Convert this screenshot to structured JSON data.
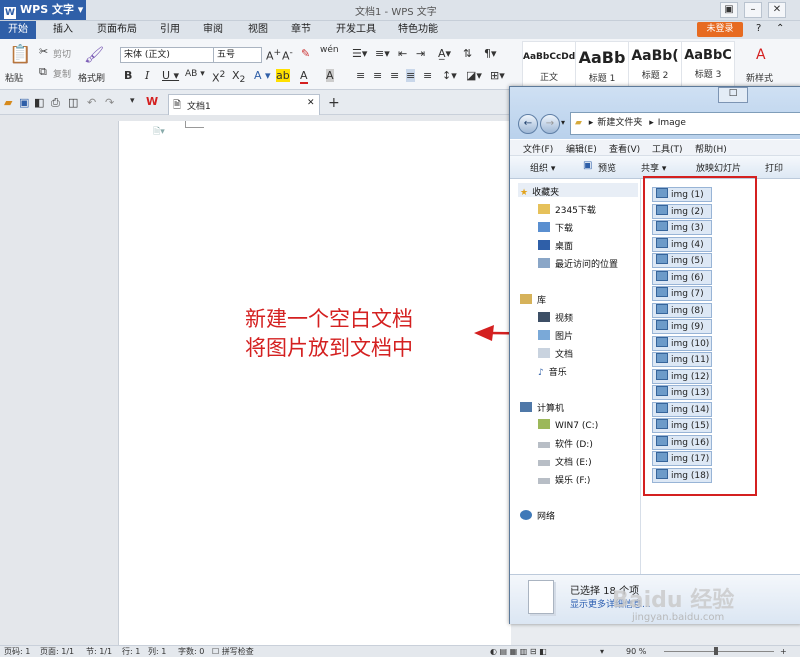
{
  "titlebar": {
    "app_name": "WPS 文字",
    "doc_title": "文档1 - WPS 文字",
    "login": "未登录"
  },
  "menu_tabs": [
    "开始",
    "插入",
    "页面布局",
    "引用",
    "审阅",
    "视图",
    "章节",
    "开发工具",
    "特色功能"
  ],
  "ribbon": {
    "paste": "粘贴",
    "cut": "剪切",
    "copy": "复制",
    "format_painter": "格式刷",
    "font_name": "宋体 (正文)",
    "font_size": "五号",
    "styles": [
      {
        "sample": "AaBbCcDd",
        "name": "正文"
      },
      {
        "sample": "AaBb",
        "name": "标题 1"
      },
      {
        "sample": "AaBb(",
        "name": "标题 2"
      },
      {
        "sample": "AaBbC",
        "name": "标题 3"
      }
    ],
    "new_style": "新样式"
  },
  "doc_tab": {
    "label": "文档1"
  },
  "annotation": {
    "line1": "新建一个空白文档",
    "line2": "将图片放到文档中"
  },
  "explorer": {
    "address": [
      "新建文件夹",
      "Image"
    ],
    "menu": [
      "文件(F)",
      "编辑(E)",
      "查看(V)",
      "工具(T)",
      "帮助(H)"
    ],
    "commands": [
      "组织",
      "预览",
      "共享",
      "放映幻灯片",
      "打印"
    ],
    "nav": {
      "favorites": "收藏夹",
      "fav_items": [
        "2345下载",
        "下载",
        "桌面",
        "最近访问的位置"
      ],
      "libraries": "库",
      "lib_items": [
        "视频",
        "图片",
        "文档",
        "音乐"
      ],
      "computer": "计算机",
      "drives": [
        "WIN7 (C:)",
        "软件 (D:)",
        "文档 (E:)",
        "娱乐 (F:)"
      ],
      "network": "网络"
    },
    "files": [
      "img (1)",
      "img (2)",
      "img (3)",
      "img (4)",
      "img (5)",
      "img (6)",
      "img (7)",
      "img (8)",
      "img (9)",
      "img (10)",
      "img (11)",
      "img (12)",
      "img (13)",
      "img (14)",
      "img (15)",
      "img (16)",
      "img (17)",
      "img (18)"
    ],
    "status_main": "已选择 18 个项",
    "status_sub": "显示更多详细信息..."
  },
  "statusbar": {
    "page": "页码: 1",
    "pages": "页面: 1/1",
    "section": "节: 1/1",
    "row": "行: 1",
    "col": "列: 1",
    "words": "字数: 0",
    "spell": "拼写检查",
    "zoom": "90 %"
  },
  "watermark": {
    "text": "Baidu 经验",
    "url": "jingyan.baidu.com"
  }
}
